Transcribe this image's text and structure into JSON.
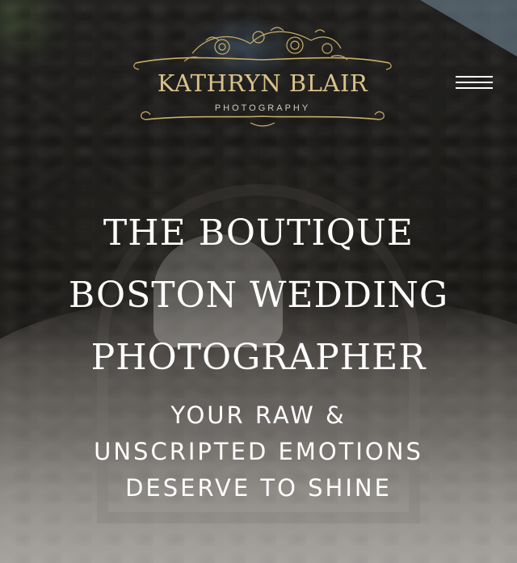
{
  "brand": {
    "name": "KATHRYN BLAIR",
    "tagline": "PHOTOGRAPHY",
    "logo_icon": "floral-ornament",
    "gold_color": "#d9c28a"
  },
  "nav": {
    "menu_icon": "hamburger-menu-icon"
  },
  "hero": {
    "headline_lines": [
      "THE BOUTIQUE",
      "BOSTON WEDDING",
      "PHOTOGRAPHER"
    ],
    "subhead_lines": [
      "YOUR RAW &",
      "UNSCRIPTED EMOTIONS",
      "DESERVE TO SHINE"
    ],
    "background": "bride-veil-stone-chapel-photo"
  }
}
